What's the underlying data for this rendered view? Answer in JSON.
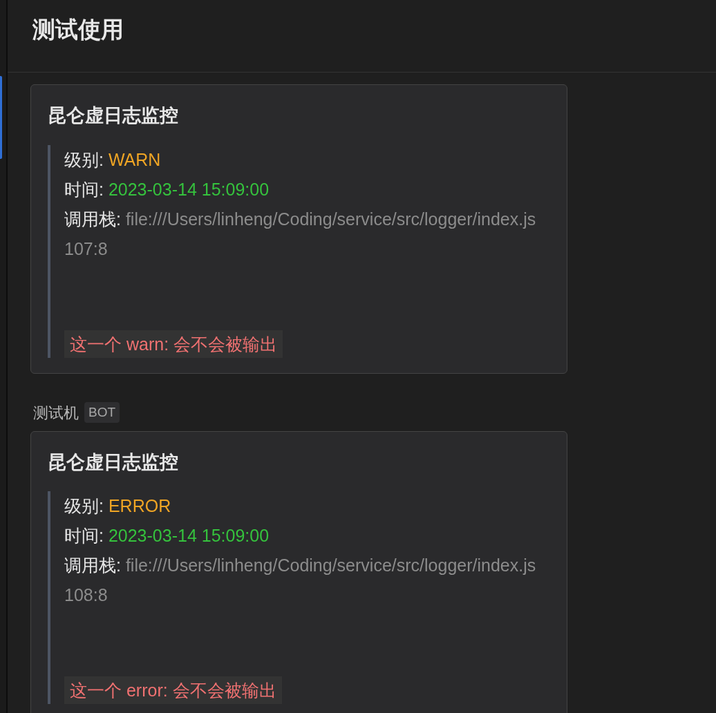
{
  "header": {
    "title": "测试使用"
  },
  "messages": [
    {
      "card": {
        "title": "昆仑虚日志监控",
        "fields": [
          {
            "label": "级别:",
            "value": "WARN",
            "kind": "level"
          },
          {
            "label": "时间:",
            "value": "2023-03-14 15:09:00",
            "kind": "time"
          },
          {
            "label": "调用栈:",
            "value": "file:///Users/linheng/Coding/service/src/logger/index.js 107:8",
            "kind": "stack"
          }
        ],
        "code": "这一个 warn: 会不会被输出"
      }
    },
    {
      "sender": "测试机",
      "badge": "BOT",
      "card": {
        "title": "昆仑虚日志监控",
        "fields": [
          {
            "label": "级别:",
            "value": "ERROR",
            "kind": "level"
          },
          {
            "label": "时间:",
            "value": "2023-03-14 15:09:00",
            "kind": "time"
          },
          {
            "label": "调用栈:",
            "value": "file:///Users/linheng/Coding/service/src/logger/index.js 108:8",
            "kind": "stack"
          }
        ],
        "code": "这一个 error: 会不会被输出"
      }
    }
  ]
}
